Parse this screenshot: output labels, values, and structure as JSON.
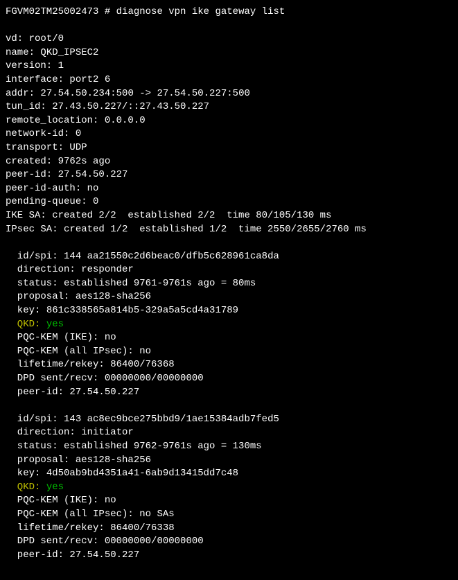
{
  "prompt": {
    "hostname": "FGVM02TM25002473",
    "separator": " # ",
    "command": "diagnose vpn ike gateway list"
  },
  "header": {
    "vd_label": "vd: ",
    "vd_value": "root/0",
    "name_label": "name: ",
    "name_value": "QKD_IPSEC2",
    "version_label": "version: ",
    "version_value": "1",
    "interface_label": "interface: ",
    "interface_value": "port2 6",
    "addr_label": "addr: ",
    "addr_value": "27.54.50.234:500 -> 27.54.50.227:500",
    "tun_id_label": "tun_id: ",
    "tun_id_value": "27.43.50.227/::27.43.50.227",
    "remote_location_label": "remote_location: ",
    "remote_location_value": "0.0.0.0",
    "network_id_label": "network-id: ",
    "network_id_value": "0",
    "transport_label": "transport: ",
    "transport_value": "UDP",
    "created_label": "created: ",
    "created_value": "9762s ago",
    "peer_id_label": "peer-id: ",
    "peer_id_value": "27.54.50.227",
    "peer_id_auth_label": "peer-id-auth: ",
    "peer_id_auth_value": "no",
    "pending_queue_label": "pending-queue: ",
    "pending_queue_value": "0",
    "ike_sa_line": "IKE SA: created 2/2  established 2/2  time 80/105/130 ms",
    "ipsec_sa_line": "IPsec SA: created 1/2  established 1/2  time 2550/2655/2760 ms"
  },
  "sa": [
    {
      "id_spi_label": "id/spi: ",
      "id_spi_value": "144 aa21550c2d6beac0/dfb5c628961ca8da",
      "direction_label": "direction: ",
      "direction_value": "responder",
      "status_label": "status: ",
      "status_value": "established 9761-9761s ago = 80ms",
      "proposal_label": "proposal: ",
      "proposal_value": "aes128-sha256",
      "key_label": "key: ",
      "key_value": "861c338565a814b5-329a5a5cd4a31789",
      "qkd_label": "QKD: ",
      "qkd_value": "yes",
      "pqc_kem_ike_label": "PQC-KEM (IKE)",
      "pqc_kem_ike_colon": ": ",
      "pqc_kem_ike_value": "no",
      "pqc_kem_ipsec_label": "PQC-KEM (all IPsec): ",
      "pqc_kem_ipsec_value": "no",
      "lifetime_label": "lifetime/rekey: ",
      "lifetime_value": "86400/76368",
      "dpd_label": "DPD sent/recv: ",
      "dpd_value": "00000000/00000000",
      "peer_id_label": "peer-id: ",
      "peer_id_value": "27.54.50.227"
    },
    {
      "id_spi_label": "id/spi: ",
      "id_spi_value": "143 ac8ec9bce275bbd9/1ae15384adb7fed5",
      "direction_label": "direction: ",
      "direction_value": "initiator",
      "status_label": "status: ",
      "status_value": "established 9762-9761s ago = 130ms",
      "proposal_label": "proposal: ",
      "proposal_value": "aes128-sha256",
      "key_label": "key: ",
      "key_value": "4d50ab9bd4351a41-6ab9d13415dd7c48",
      "qkd_label": "QKD: ",
      "qkd_value": "yes",
      "pqc_kem_ike_label": "PQC-KEM (IKE)",
      "pqc_kem_ike_colon": ": ",
      "pqc_kem_ike_value": "no",
      "pqc_kem_ipsec_label": "PQC-KEM (all IPsec): ",
      "pqc_kem_ipsec_value": "no SAs",
      "lifetime_label": "lifetime/rekey: ",
      "lifetime_value": "86400/76338",
      "dpd_label": "DPD sent/recv: ",
      "dpd_value": "00000000/00000000",
      "peer_id_label": "peer-id: ",
      "peer_id_value": "27.54.50.227"
    }
  ]
}
